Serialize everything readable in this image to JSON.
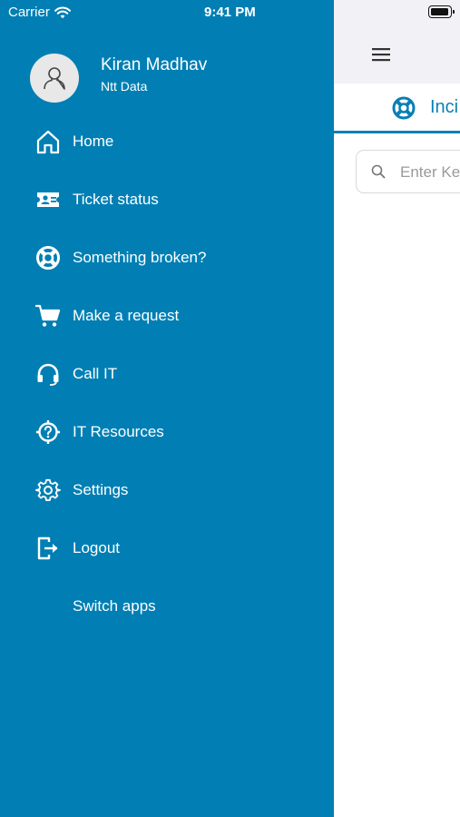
{
  "status_bar": {
    "carrier": "Carrier",
    "time": "9:41 PM"
  },
  "user": {
    "name": "Kiran Madhav",
    "org": "Ntt Data"
  },
  "menu": {
    "items": [
      {
        "label": "Home",
        "icon": "home-icon"
      },
      {
        "label": "Ticket status",
        "icon": "ticket-icon"
      },
      {
        "label": "Something broken?",
        "icon": "lifebuoy-icon"
      },
      {
        "label": "Make a request",
        "icon": "cart-icon"
      },
      {
        "label": "Call IT",
        "icon": "headset-icon"
      },
      {
        "label": "IT Resources",
        "icon": "help-target-icon"
      },
      {
        "label": "Settings",
        "icon": "gear-icon"
      },
      {
        "label": "Logout",
        "icon": "logout-icon"
      },
      {
        "label": "Switch apps",
        "icon": ""
      }
    ]
  },
  "main": {
    "tab_label": "Inci",
    "search_placeholder": "Enter Ke"
  },
  "colors": {
    "drawer_bg": "#017fb4",
    "accent": "#0a7fb3",
    "header_bg": "#f2f2f6"
  }
}
